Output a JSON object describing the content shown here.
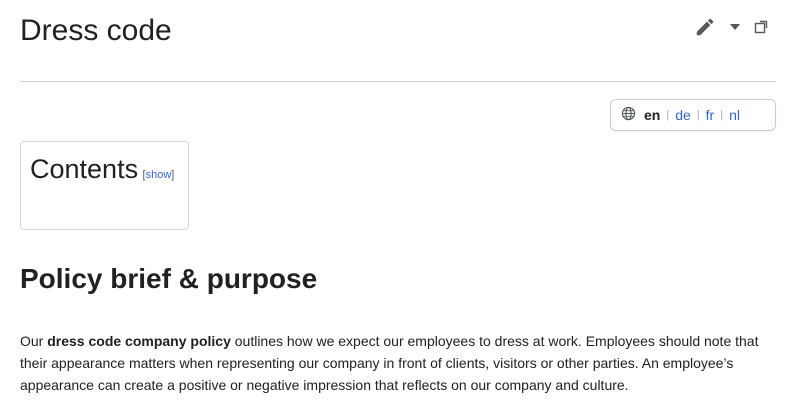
{
  "page": {
    "title": "Dress code"
  },
  "tools": {
    "edit_icon": "pencil-icon",
    "menu_icon": "caret-down-icon",
    "expand_icon": "expand-icon"
  },
  "languages": {
    "icon": "globe-icon",
    "current": "en",
    "separator": "|",
    "items": [
      "de",
      "fr",
      "nl"
    ]
  },
  "toc": {
    "title": "Contents",
    "toggle_open": "[",
    "toggle_label": "show",
    "toggle_close": "]"
  },
  "section": {
    "heading": "Policy brief & purpose",
    "para_prefix": "Our ",
    "para_bold": "dress code company policy",
    "para_rest": " outlines how we expect our employees to dress at work. Employees should note that their appearance matters when representing our company in front of clients, visitors or other parties. An employee’s appearance can create a positive or negative impression that reflects on our company and culture."
  },
  "colors": {
    "text": "#202122",
    "link": "#3366cc",
    "border": "#c8ccd1"
  }
}
